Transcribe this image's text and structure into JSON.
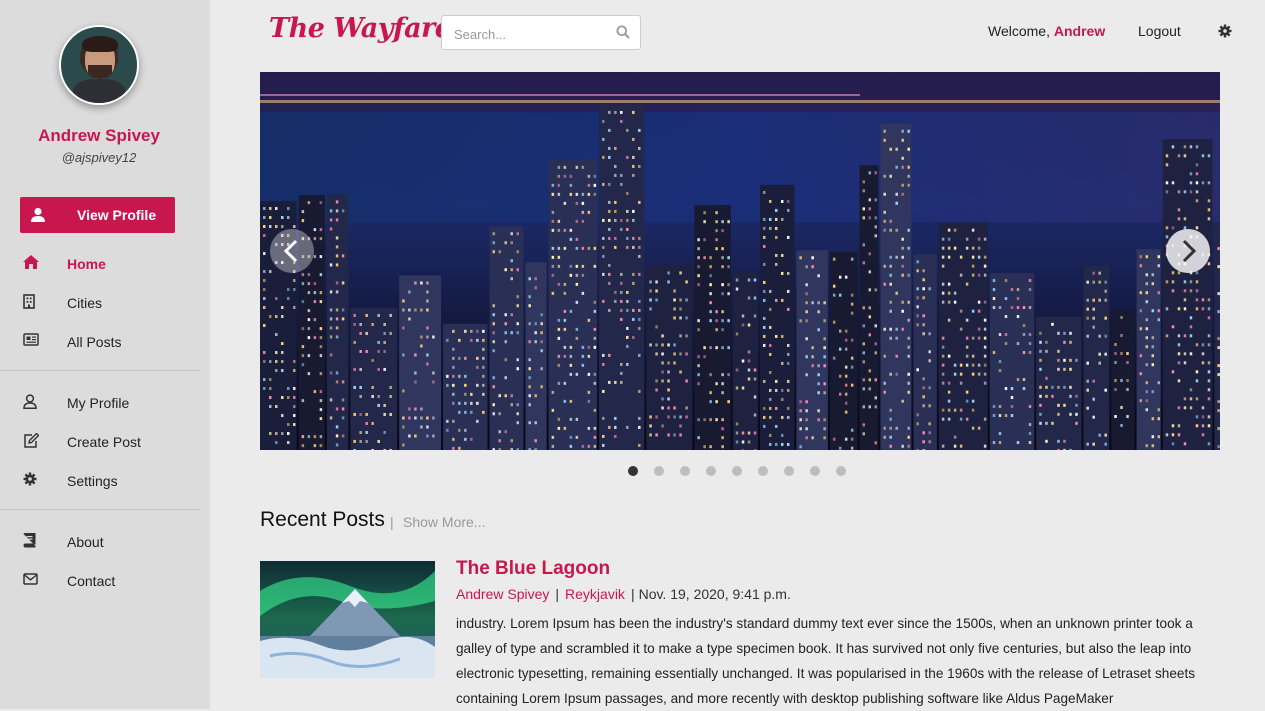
{
  "sidebar": {
    "user": {
      "name": "Andrew Spivey",
      "handle": "@ajspivey12"
    },
    "view_profile_label": "View Profile",
    "nav_main": [
      {
        "label": "Home",
        "icon": "home-icon",
        "active": true
      },
      {
        "label": "Cities",
        "icon": "building-icon",
        "active": false
      },
      {
        "label": "All Posts",
        "icon": "newspaper-icon",
        "active": false
      }
    ],
    "nav_user": [
      {
        "label": "My Profile",
        "icon": "user-icon"
      },
      {
        "label": "Create Post",
        "icon": "edit-icon"
      },
      {
        "label": "Settings",
        "icon": "gear-icon"
      }
    ],
    "nav_info": [
      {
        "label": "About",
        "icon": "book-icon"
      },
      {
        "label": "Contact",
        "icon": "envelope-icon"
      }
    ]
  },
  "header": {
    "logo": "The Wayfarer",
    "search_placeholder": "Search...",
    "welcome_prefix": "Welcome, ",
    "welcome_name": "Andrew",
    "logout_label": "Logout"
  },
  "carousel": {
    "slide_count": 9,
    "active_index": 0
  },
  "recent": {
    "title": "Recent Posts",
    "separator": "|",
    "show_more": "Show More...",
    "posts": [
      {
        "title": "The Blue Lagoon",
        "author": "Andrew Spivey",
        "city": "Reykjavik",
        "date": "Nov. 19, 2020, 9:41 p.m.",
        "body": "industry. Lorem Ipsum has been the industry's standard dummy text ever since the 1500s, when an unknown printer took a galley of type and scrambled it to make a type specimen book. It has survived not only five centuries, but also the leap into electronic typesetting, remaining essentially unchanged. It was popularised in the 1960s with the release of Letraset sheets containing Lorem Ipsum passages, and more recently with desktop publishing software like Aldus PageMaker"
      }
    ]
  },
  "colors": {
    "accent": "#c8174f",
    "sidebar_bg": "#dcdcdc",
    "page_bg": "#ebebeb"
  }
}
